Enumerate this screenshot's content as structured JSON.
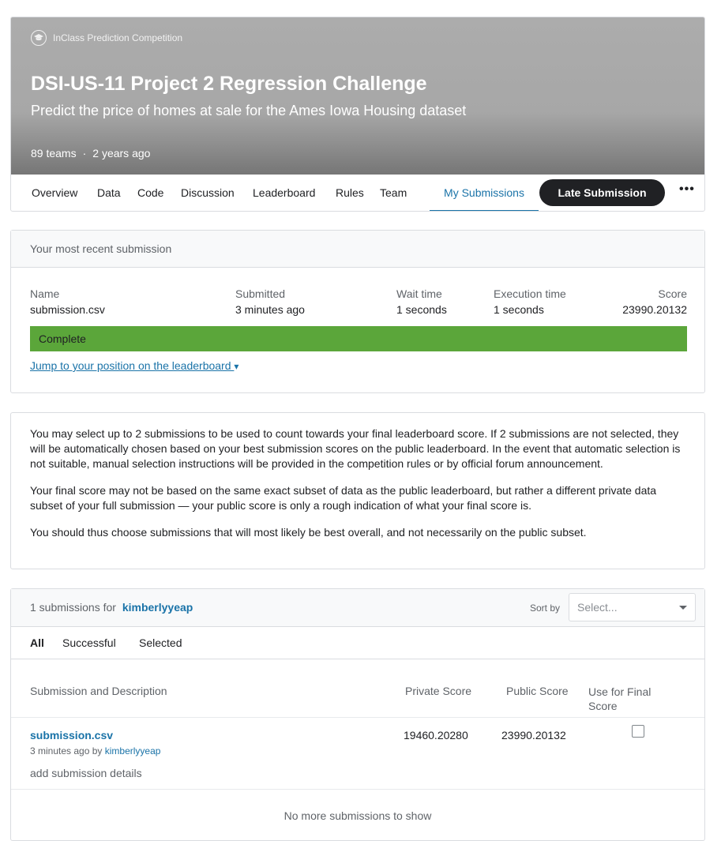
{
  "header": {
    "competition_type": "InClass Prediction Competition",
    "cap_icon": "graduation-cap-icon",
    "title": "DSI-US-11 Project 2 Regression Challenge",
    "subtitle": "Predict the price of homes at sale for the Ames Iowa Housing dataset",
    "teams": "89 teams",
    "separator": "·",
    "age": "2 years ago"
  },
  "tabs": [
    {
      "label": "Overview"
    },
    {
      "label": "Data"
    },
    {
      "label": "Code"
    },
    {
      "label": "Discussion"
    },
    {
      "label": "Leaderboard"
    },
    {
      "label": "Rules"
    },
    {
      "label": "Team"
    },
    {
      "label": "My Submissions",
      "active": true
    }
  ],
  "late_submission_label": "Late Submission",
  "more_label": "•••",
  "recent": {
    "heading": "Your most recent submission",
    "name_label": "Name",
    "name_value": "submission.csv",
    "submitted_label": "Submitted",
    "submitted_value": "3 minutes ago",
    "wait_label": "Wait time",
    "wait_value": "1 seconds",
    "exec_label": "Execution time",
    "exec_value": "1 seconds",
    "score_label": "Score",
    "score_value": "23990.20132",
    "status": "Complete",
    "status_color": "#5ba63a",
    "jump_link": "Jump to your position on the leaderboard",
    "jump_caret": "▾"
  },
  "info": {
    "p1": "You may select up to 2 submissions to be used to count towards your final leaderboard score. If 2 submissions are not selected, they will be automatically chosen based on your best submission scores on the public leaderboard. In the event that automatic selection is not suitable, manual selection instructions will be provided in the competition rules or by official forum announcement.",
    "p2": "Your final score may not be based on the same exact subset of data as the public leaderboard, but rather a different private data subset of your full submission — your public score is only a rough indication of what your final score is.",
    "p3": "You should thus choose submissions that will most likely be best overall, and not necessarily on the public subset."
  },
  "submissions": {
    "count_text": "1 submissions for",
    "user": "kimberlyyeap",
    "sort_label": "Sort by",
    "sort_placeholder": "Select...",
    "filters": [
      "All",
      "Successful",
      "Selected"
    ],
    "columns": {
      "desc": "Submission and Description",
      "private": "Private Score",
      "public": "Public Score",
      "final_line1": "Use for Final",
      "final_line2": "Score"
    },
    "rows": [
      {
        "file": "submission.csv",
        "meta": "3 minutes ago by",
        "user": "kimberlyyeap",
        "details": "add submission details",
        "private": "19460.20280",
        "public": "23990.20132",
        "selected": false
      }
    ],
    "footer": "No more submissions to show"
  },
  "colors": {
    "accent": "#1a73a8",
    "dark_button": "#202124"
  }
}
